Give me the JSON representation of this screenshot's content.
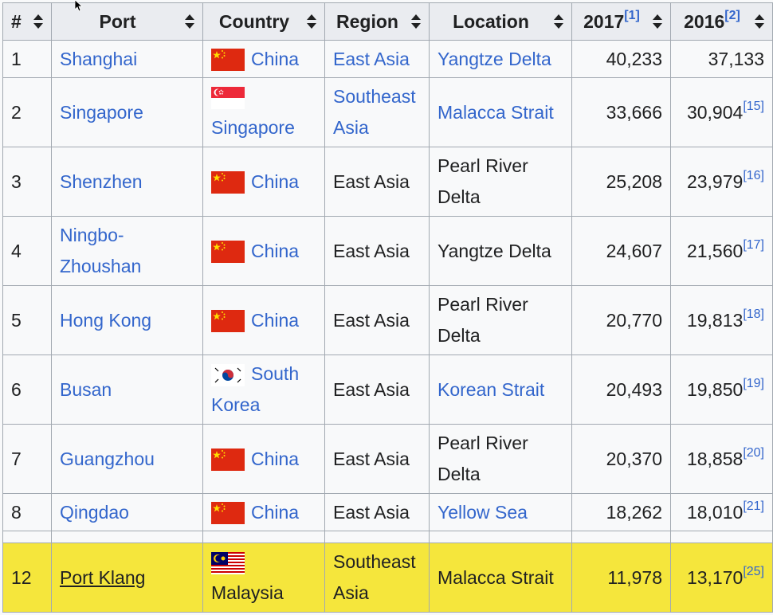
{
  "headers": [
    "#",
    "Port",
    "Country",
    "Region",
    "Location",
    "2017",
    "2016"
  ],
  "header_refs": {
    "2017": "[1]",
    "2016": "[2]"
  },
  "rows": [
    {
      "rank": "1",
      "port": "Shanghai",
      "country": "China",
      "flag": "china-flag-icon",
      "region": "East Asia",
      "region_link": true,
      "location": "Yangtze Delta",
      "location_link": true,
      "v2017": "40,233",
      "v2016": "37,133",
      "ref": ""
    },
    {
      "rank": "2",
      "port": "Singapore",
      "country": "Singapore",
      "flag": "singapore-flag-icon",
      "region": "Southeast Asia",
      "region_link": true,
      "location": "Malacca Strait",
      "location_link": true,
      "v2017": "33,666",
      "v2016": "30,904",
      "ref": "[15]"
    },
    {
      "rank": "3",
      "port": "Shenzhen",
      "country": "China",
      "flag": "china-flag-icon",
      "region": "East Asia",
      "region_link": false,
      "location": "Pearl River Delta",
      "location_link": false,
      "v2017": "25,208",
      "v2016": "23,979",
      "ref": "[16]"
    },
    {
      "rank": "4",
      "port": "Ningbo-Zhoushan",
      "country": "China",
      "flag": "china-flag-icon",
      "region": "East Asia",
      "region_link": false,
      "location": "Yangtze Delta",
      "location_link": false,
      "v2017": "24,607",
      "v2016": "21,560",
      "ref": "[17]"
    },
    {
      "rank": "5",
      "port": "Hong Kong",
      "country": "China",
      "flag": "china-flag-icon",
      "region": "East Asia",
      "region_link": false,
      "location": "Pearl River Delta",
      "location_link": false,
      "v2017": "20,770",
      "v2016": "19,813",
      "ref": "[18]"
    },
    {
      "rank": "6",
      "port": "Busan",
      "country": "South Korea",
      "flag": "south-korea-flag-icon",
      "region": "East Asia",
      "region_link": false,
      "location": "Korean Strait",
      "location_link": true,
      "v2017": "20,493",
      "v2016": "19,850",
      "ref": "[19]"
    },
    {
      "rank": "7",
      "port": "Guangzhou",
      "country": "China",
      "flag": "china-flag-icon",
      "region": "East Asia",
      "region_link": false,
      "location": "Pearl River Delta",
      "location_link": false,
      "v2017": "20,370",
      "v2016": "18,858",
      "ref": "[20]"
    },
    {
      "rank": "8",
      "port": "Qingdao",
      "country": "China",
      "flag": "china-flag-icon",
      "region": "East Asia",
      "region_link": false,
      "location": "Yellow Sea",
      "location_link": true,
      "v2017": "18,262",
      "v2016": "18,010",
      "ref": "[21]"
    }
  ],
  "highlight_row": {
    "rank": "12",
    "port": "Port Klang",
    "country": "Malaysia",
    "flag": "malaysia-flag-icon",
    "region": "Southeast Asia",
    "location": "Malacca Strait",
    "v2017": "11,978",
    "v2016": "13,170",
    "ref": "[25]"
  },
  "colors": {
    "link": "#3366cc",
    "header_bg": "#eaecf0",
    "cell_bg": "#f8f9fa",
    "border": "#a2a9b1",
    "highlight": "#f5e63c"
  }
}
